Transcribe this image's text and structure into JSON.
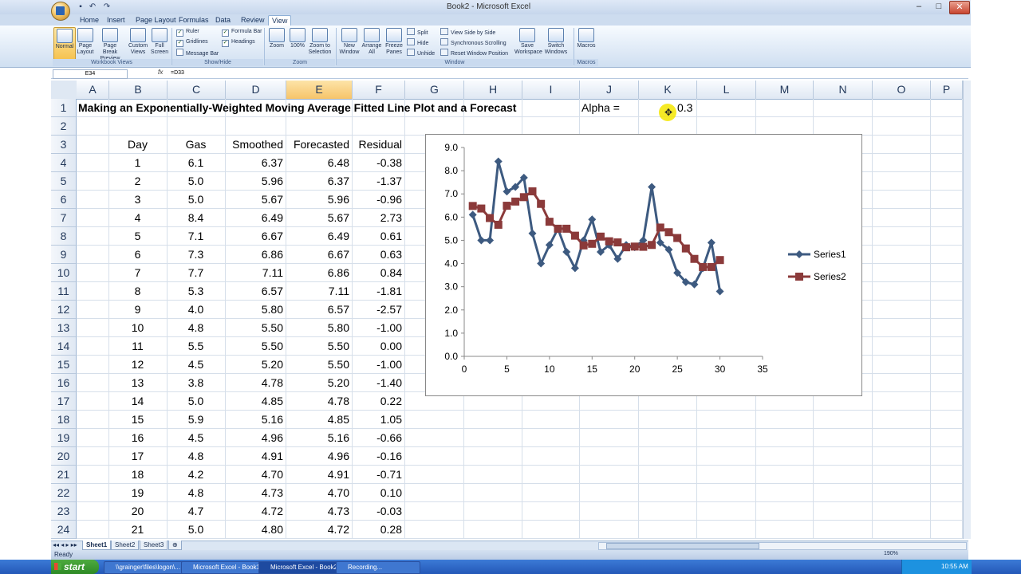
{
  "window": {
    "title": "Book2 - Microsoft Excel",
    "minimize": "–",
    "maximize": "□",
    "close": "✕"
  },
  "qat": {
    "save": "▪",
    "undo": "↶",
    "redo": "↷"
  },
  "tabs": [
    "Home",
    "Insert",
    "Page Layout",
    "Formulas",
    "Data",
    "Review",
    "View"
  ],
  "ribbon": {
    "workbook_views": {
      "label": "Workbook Views",
      "normal": "Normal",
      "page_layout": "Page Layout",
      "page_break": "Page Break Preview",
      "custom_views": "Custom Views",
      "full_screen": "Full Screen"
    },
    "show_hide": {
      "label": "Show/Hide",
      "ruler": "Ruler",
      "gridlines": "Gridlines",
      "message_bar": "Message Bar",
      "formula_bar": "Formula Bar",
      "headings": "Headings"
    },
    "zoom": {
      "label": "Zoom",
      "zoom": "Zoom",
      "hundred": "100%",
      "zoom_to_selection": "Zoom to Selection"
    },
    "window": {
      "label": "Window",
      "new_window": "New Window",
      "arrange_all": "Arrange All",
      "freeze_panes": "Freeze Panes",
      "split": "Split",
      "hide": "Hide",
      "unhide": "Unhide",
      "side_by_side": "View Side by Side",
      "sync_scrolling": "Synchronous Scrolling",
      "reset_position": "Reset Window Position",
      "save_workspace": "Save Workspace",
      "switch_windows": "Switch Windows"
    },
    "macros": {
      "label": "Macros",
      "macros": "Macros"
    }
  },
  "formula_bar": {
    "name_box": "E34",
    "fx": "fx",
    "formula": "=D33"
  },
  "columns": [
    "A",
    "B",
    "C",
    "D",
    "E",
    "F",
    "G",
    "H",
    "I",
    "J",
    "K",
    "L",
    "M",
    "N",
    "O",
    "P"
  ],
  "rows": [
    "1",
    "2",
    "3",
    "4",
    "5",
    "6",
    "7",
    "8",
    "9",
    "10",
    "11",
    "12",
    "13",
    "14",
    "15",
    "16",
    "17",
    "18",
    "19",
    "20",
    "21",
    "22",
    "23",
    "24"
  ],
  "sheet": {
    "title": "Making an Exponentially-Weighted Moving Average Fitted Line Plot and a Forecast",
    "alpha_label": "Alpha =",
    "alpha_value": "0.3",
    "headers": [
      "Day",
      "Gas",
      "Smoothed",
      "Forecasted",
      "Residual"
    ],
    "table": [
      [
        "1",
        "6.1",
        "6.37",
        "6.48",
        "-0.38"
      ],
      [
        "2",
        "5.0",
        "5.96",
        "6.37",
        "-1.37"
      ],
      [
        "3",
        "5.0",
        "5.67",
        "5.96",
        "-0.96"
      ],
      [
        "4",
        "8.4",
        "6.49",
        "5.67",
        "2.73"
      ],
      [
        "5",
        "7.1",
        "6.67",
        "6.49",
        "0.61"
      ],
      [
        "6",
        "7.3",
        "6.86",
        "6.67",
        "0.63"
      ],
      [
        "7",
        "7.7",
        "7.11",
        "6.86",
        "0.84"
      ],
      [
        "8",
        "5.3",
        "6.57",
        "7.11",
        "-1.81"
      ],
      [
        "9",
        "4.0",
        "5.80",
        "6.57",
        "-2.57"
      ],
      [
        "10",
        "4.8",
        "5.50",
        "5.80",
        "-1.00"
      ],
      [
        "11",
        "5.5",
        "5.50",
        "5.50",
        "0.00"
      ],
      [
        "12",
        "4.5",
        "5.20",
        "5.50",
        "-1.00"
      ],
      [
        "13",
        "3.8",
        "4.78",
        "5.20",
        "-1.40"
      ],
      [
        "14",
        "5.0",
        "4.85",
        "4.78",
        "0.22"
      ],
      [
        "15",
        "5.9",
        "5.16",
        "4.85",
        "1.05"
      ],
      [
        "16",
        "4.5",
        "4.96",
        "5.16",
        "-0.66"
      ],
      [
        "17",
        "4.8",
        "4.91",
        "4.96",
        "-0.16"
      ],
      [
        "18",
        "4.2",
        "4.70",
        "4.91",
        "-0.71"
      ],
      [
        "19",
        "4.8",
        "4.73",
        "4.70",
        "0.10"
      ],
      [
        "20",
        "4.7",
        "4.72",
        "4.73",
        "-0.03"
      ],
      [
        "21",
        "5.0",
        "4.80",
        "4.72",
        "0.28"
      ]
    ]
  },
  "chart_data": {
    "type": "line",
    "xlim": [
      0,
      35
    ],
    "ylim": [
      0,
      9
    ],
    "x_ticks": [
      "0",
      "5",
      "10",
      "15",
      "20",
      "25",
      "30",
      "35"
    ],
    "y_ticks": [
      "0.0",
      "1.0",
      "2.0",
      "3.0",
      "4.0",
      "5.0",
      "6.0",
      "7.0",
      "8.0",
      "9.0"
    ],
    "legend": "right",
    "grid": false,
    "series": [
      {
        "name": "Series1",
        "color": "#3d5a80",
        "marker": "diamond",
        "x": [
          1,
          2,
          3,
          4,
          5,
          6,
          7,
          8,
          9,
          10,
          11,
          12,
          13,
          14,
          15,
          16,
          17,
          18,
          19,
          20,
          21,
          22,
          23,
          24,
          25,
          26,
          27,
          28,
          29,
          30
        ],
        "y": [
          6.1,
          5.0,
          5.0,
          8.4,
          7.1,
          7.3,
          7.7,
          5.3,
          4.0,
          4.8,
          5.5,
          4.5,
          3.8,
          5.0,
          5.9,
          4.5,
          4.8,
          4.2,
          4.8,
          4.7,
          5.0,
          7.3,
          4.9,
          4.6,
          3.6,
          3.2,
          3.1,
          3.8,
          4.9,
          2.8
        ]
      },
      {
        "name": "Series2",
        "color": "#8b3a3a",
        "marker": "square",
        "x": [
          1,
          2,
          3,
          4,
          5,
          6,
          7,
          8,
          9,
          10,
          11,
          12,
          13,
          14,
          15,
          16,
          17,
          18,
          19,
          20,
          21,
          22,
          23,
          24,
          25,
          26,
          27,
          28,
          29,
          30
        ],
        "y": [
          6.48,
          6.37,
          5.96,
          5.67,
          6.49,
          6.67,
          6.86,
          7.11,
          6.57,
          5.8,
          5.5,
          5.5,
          5.2,
          4.78,
          4.85,
          5.16,
          4.96,
          4.91,
          4.7,
          4.73,
          4.72,
          4.8,
          5.55,
          5.35,
          5.1,
          4.65,
          4.2,
          3.85,
          3.85,
          4.15
        ]
      }
    ]
  },
  "sheet_tabs": [
    "Sheet1",
    "Sheet2",
    "Sheet3"
  ],
  "status": {
    "ready": "Ready",
    "zoom": "190%"
  },
  "taskbar": {
    "start": "start",
    "items": [
      "\\\\grainger\\files\\logon\\...",
      "Microsoft Excel - Book1",
      "Microsoft Excel - Book2",
      "Recording..."
    ],
    "clock": "10:55 AM"
  }
}
